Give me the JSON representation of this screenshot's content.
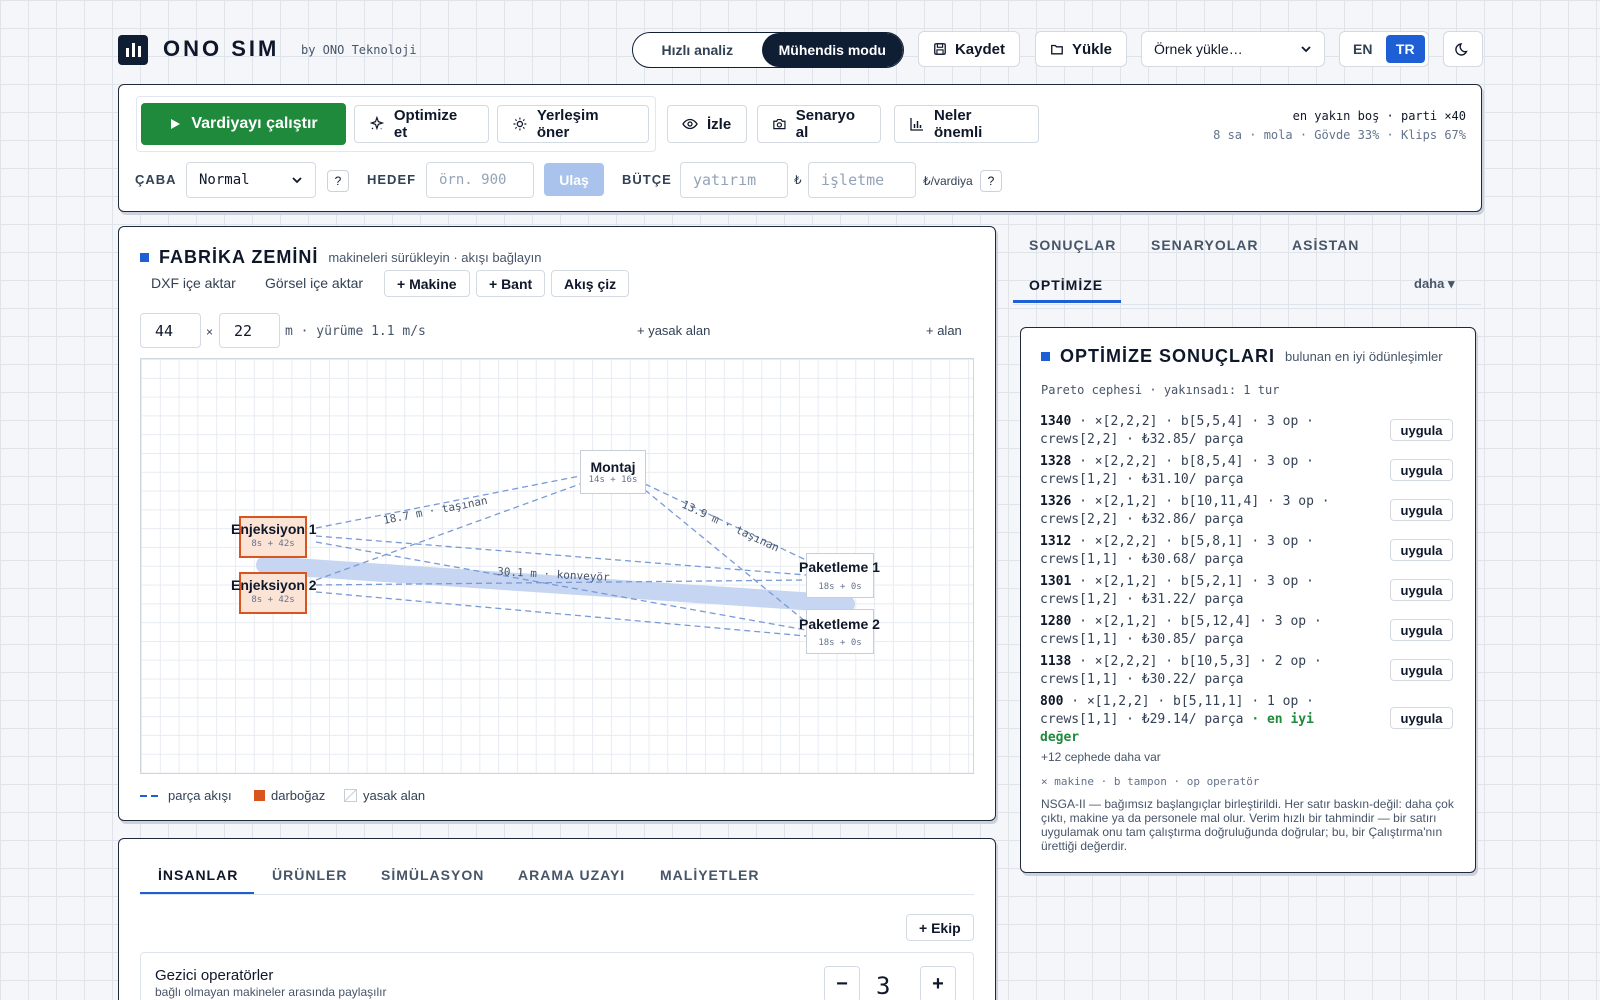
{
  "header": {
    "brand": "ONO SIM",
    "byline": "by ONO Teknoloji",
    "mode_quick": "Hızlı analiz",
    "mode_engineer": "Mühendis modu",
    "save_label": "Kaydet",
    "load_label": "Yükle",
    "example_select": "Örnek yükle…",
    "lang_en": "EN",
    "lang_tr": "TR"
  },
  "toolbar": {
    "run_label": "Vardiyayı çalıştır",
    "optimize_label": "Optimize et",
    "layout_label": "Yerleşim öner",
    "watch_label": "İzle",
    "scenario_label": "Senaryo al",
    "matters_label": "Neler önemli",
    "hint_line1": "en yakın boş · parti ×40",
    "hint_line2": "8 sa · mola · Gövde 33% · Klips 67%",
    "effort_label": "ÇABA",
    "effort_value": "Normal",
    "help": "?",
    "target_label": "HEDEF",
    "target_placeholder": "örn. 900",
    "reach_label": "Ulaş",
    "budget_label": "BÜTÇE",
    "invest_placeholder": "yatırım",
    "currency": "₺",
    "operate_placeholder": "işletme",
    "per_shift": "₺/vardiya"
  },
  "floor": {
    "title": "FABRİKA ZEMİNİ",
    "subtitle": "makineleri sürükleyin · akışı bağlayın",
    "import_dxf": "DXF içe aktar",
    "import_image": "Görsel içe aktar",
    "add_machine": "+ Makine",
    "add_belt": "+ Bant",
    "draw_flow": "Akış çiz",
    "width": "44",
    "times": "×",
    "depth": "22",
    "unit_walk": "m · yürüme 1.1 m/s",
    "add_forbidden": "+ yasak alan",
    "add_area": "+ alan",
    "nodes": {
      "montaj": {
        "name": "Montaj",
        "times": "14s + 16s"
      },
      "enj1": {
        "name": "Enjeksiyon 1",
        "times": "8s + 42s"
      },
      "enj2": {
        "name": "Enjeksiyon 2",
        "times": "8s + 42s"
      },
      "pak1": {
        "name": "Paketleme 1",
        "times": "18s + 0s"
      },
      "pak2": {
        "name": "Paketleme 2",
        "times": "18s + 0s"
      }
    },
    "edge_labels": {
      "e1": "18.7 m · taşınan",
      "e2": "13.9 m · taşınan",
      "e3": "30.1 m · konveyör"
    },
    "legend_flow": "parça akışı",
    "legend_bottleneck": "darboğaz",
    "legend_forbidden": "yasak alan"
  },
  "right_tabs": {
    "results": "SONUÇLAR",
    "scenarios": "SENARYOLAR",
    "assistant": "ASİSTAN",
    "optimize": "OPTİMİZE",
    "more": "daha ▾"
  },
  "optimize": {
    "title": "OPTİMİZE SONUÇLARI",
    "subtitle": "bulunan en iyi ödünleşimler",
    "pareto": "Pareto cephesi · yakınsadı: 1 tur",
    "apply": "uygula",
    "rows": [
      {
        "value": "1340",
        "l1": " · ×[2,2,2] · b[5,5,4] · 3 op ·",
        "l2": "crews[2,2] · ₺32.85/ parça"
      },
      {
        "value": "1328",
        "l1": " · ×[2,2,2] · b[8,5,4] · 3 op ·",
        "l2": "crews[1,2] · ₺31.10/ parça"
      },
      {
        "value": "1326",
        "l1": " · ×[2,1,2] · b[10,11,4] · 3 op ·",
        "l2": "crews[2,2] · ₺32.86/ parça"
      },
      {
        "value": "1312",
        "l1": " · ×[2,2,2] · b[5,8,1] · 3 op ·",
        "l2": "crews[1,1] · ₺30.68/ parça"
      },
      {
        "value": "1301",
        "l1": " · ×[2,1,2] · b[5,2,1] · 3 op ·",
        "l2": "crews[1,2] · ₺31.22/ parça"
      },
      {
        "value": "1280",
        "l1": " · ×[2,1,2] · b[5,12,4] · 3 op ·",
        "l2": "crews[1,1] · ₺30.85/ parça"
      },
      {
        "value": "1138",
        "l1": " · ×[2,2,2] · b[10,5,3] · 2 op ·",
        "l2": "crews[1,1] · ₺30.22/ parça"
      },
      {
        "value": "800",
        "l1": " · ×[1,2,2] · b[5,11,1] · 1 op ·",
        "l2": "crews[1,1] · ₺29.14/ parça"
      }
    ],
    "best_tag": "· en iyi",
    "best_tag2": "değer",
    "more_front": "+12 cephede daha var",
    "key": "× makine · b tampon · op operatör",
    "note": "NSGA-II — bağımsız başlangıçlar birleştirildi. Her satır baskın-değil: daha çok çıktı, makine ya da personele mal olur. Verim hızlı bir tahmindir — bir satırı uygulamak onu tam çalıştırma doğruluğunda doğrular; bu, bir Çalıştırma'nın ürettiği değerdir."
  },
  "bottom": {
    "tabs": [
      "İNSANLAR",
      "ÜRÜNLER",
      "SİMÜLASYON",
      "ARAMA UZAYI",
      "MALİYETLER"
    ],
    "add_crew": "+ Ekip",
    "roving_title": "Gezici operatörler",
    "roving_sub": "bağlı olmayan makineler arasında paylaşılır",
    "minus": "−",
    "count": "3",
    "plus": "+"
  },
  "colors": {
    "accent_blue": "#1f5fd6",
    "run_green": "#1f8a3b",
    "bottleneck": "#d9541e",
    "flow_line": "#7a9ad6",
    "best_green": "#1f8a3b"
  }
}
